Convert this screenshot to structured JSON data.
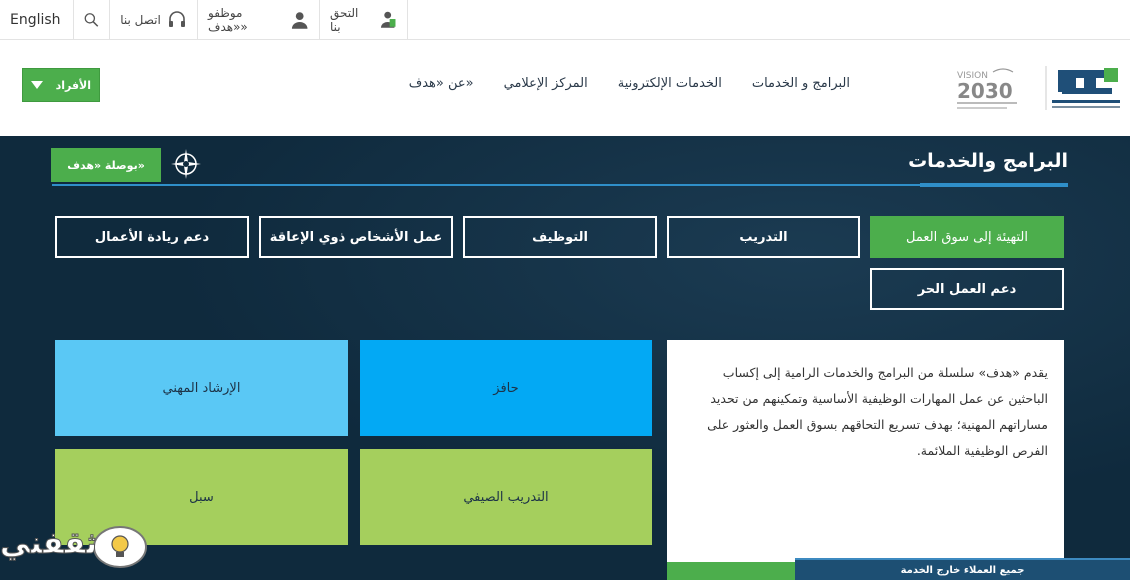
{
  "topbar": {
    "english": "English",
    "contact": "اتصل بنا",
    "staff": "موظفو «هدف»",
    "verify": "التحق بنا"
  },
  "header": {
    "individuals": "الأفراد",
    "nav": [
      "البرامج و الخدمات",
      "الخدمات الإلكترونية",
      "المركز الإعلامي",
      "عن «هدف»"
    ]
  },
  "section": {
    "title": "البرامج والخدمات",
    "compass_button": "بوصلة «هدف»"
  },
  "categories": {
    "row1": [
      "التهيئة إلى سوق العمل",
      "التدريب",
      "التوظيف",
      "عمل الأشخاص ذوي الإعاقة",
      "دعم ريادة الأعمال"
    ],
    "row2": [
      "دعم العمل الحر"
    ]
  },
  "description": "يقدم «هدف» سلسلة من البرامج والخدمات الرامية إلى إكساب الباحثين عن عمل المهارات الوظيفية الأساسية وتمكينهم من تحديد مساراتهم المهنية؛ بهدف تسريع التحاقهم بسوق العمل والعثور على الفرص الوظيفية الملائمة.",
  "tiles": {
    "career": "الإرشاد المهني",
    "hafiz": "حافز",
    "subul": "سبل",
    "summer": "التدريب الصيفي"
  },
  "bottom_bar": "جميع العملاء خارج الخدمة",
  "watermark": "ثقفني",
  "colors": {
    "accent_green": "#4cae4c",
    "dark_bg": "#0f2a3d",
    "tile_light_blue": "#5ac8f5",
    "tile_blue": "#03a9f4",
    "tile_green": "#a5cf5d"
  }
}
